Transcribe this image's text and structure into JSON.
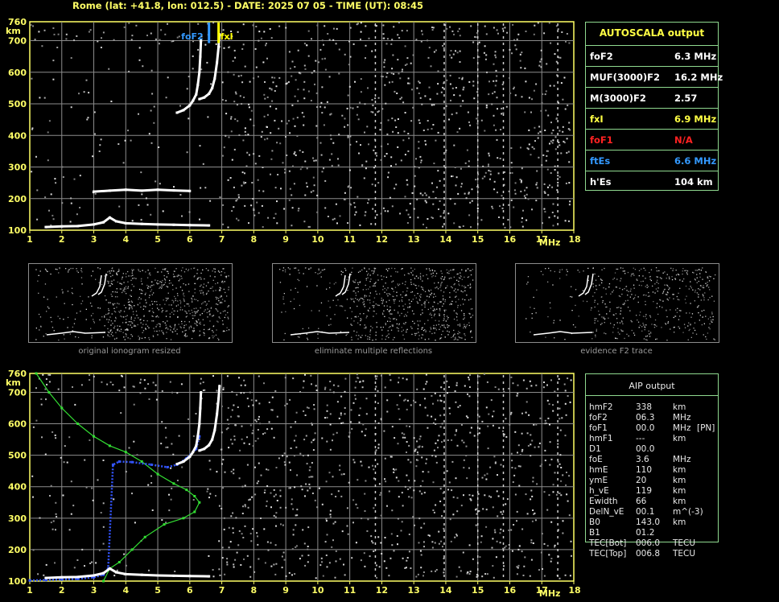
{
  "header": {
    "title": "Rome (lat: +41.8, lon: 012.5) - DATE: 2025 07 05 - TIME (UT): 08:45"
  },
  "colors": {
    "trace": "#ffffff",
    "grid": "#8c8c8c",
    "axis": "#ffff66",
    "green": "#33dd33",
    "blue": "#3355ff",
    "yellow": "#ffff00",
    "red": "#ff2222",
    "cyan_blue": "#3399ff"
  },
  "chart_data": [
    {
      "type": "scatter",
      "title": "",
      "xlabel": "MHz",
      "ylabel": "km",
      "xlim": [
        1,
        18
      ],
      "ylim": [
        100,
        760
      ],
      "x_ticks": [
        "1",
        "2",
        "3",
        "4",
        "5",
        "6",
        "7",
        "8",
        "9",
        "10",
        "11",
        "12",
        "13",
        "14",
        "15",
        "16",
        "17",
        "18"
      ],
      "y_ticks": [
        "100",
        "200",
        "300",
        "400",
        "500",
        "600",
        "700",
        "760"
      ],
      "grid": true,
      "markers": [
        {
          "label": "foF2",
          "x": 6.6,
          "color": "#3399ff"
        },
        {
          "label": "fxI",
          "x": 6.9,
          "color": "#ffff00"
        }
      ],
      "series": [
        {
          "name": "",
          "x": [
            5.6,
            5.8,
            6.0,
            6.1,
            6.2,
            6.25,
            6.3,
            6.33,
            6.35
          ],
          "y": [
            472,
            480,
            495,
            510,
            530,
            560,
            600,
            650,
            700
          ]
        },
        {
          "name": "",
          "x": [
            6.3,
            6.45,
            6.6,
            6.7,
            6.78,
            6.85,
            6.9,
            6.93
          ],
          "y": [
            515,
            520,
            532,
            550,
            580,
            630,
            680,
            720
          ]
        },
        {
          "name": "",
          "x": [
            1.5,
            2.0,
            2.5,
            3.0,
            3.3,
            3.5,
            3.7,
            4.0,
            4.5,
            5.0,
            5.5,
            6.0,
            6.6
          ],
          "y": [
            110,
            112,
            113,
            118,
            125,
            140,
            128,
            122,
            120,
            118,
            117,
            116,
            115
          ]
        },
        {
          "name": "",
          "x": [
            3.0,
            3.5,
            4.0,
            4.5,
            5.0,
            5.5,
            6.0
          ],
          "y": [
            222,
            225,
            228,
            225,
            228,
            226,
            224
          ]
        }
      ]
    },
    {
      "type": "line",
      "title": "",
      "xlabel": "MHz",
      "ylabel": "km",
      "xlim": [
        1,
        18
      ],
      "ylim": [
        100,
        760
      ],
      "x_ticks": [
        "1",
        "2",
        "3",
        "4",
        "5",
        "6",
        "7",
        "8",
        "9",
        "10",
        "11",
        "12",
        "13",
        "14",
        "15",
        "16",
        "17",
        "18"
      ],
      "y_ticks": [
        "100",
        "200",
        "300",
        "400",
        "500",
        "600",
        "700",
        "760"
      ],
      "grid": true,
      "series": [
        {
          "name": "",
          "x": [
            1.2,
            1.6,
            2.0,
            2.5,
            3.0,
            3.5,
            4.0,
            4.5,
            5.0,
            5.5,
            5.9,
            6.15,
            6.3,
            6.15,
            5.8,
            5.2,
            4.6,
            4.2,
            3.8,
            3.5,
            3.3
          ],
          "y": [
            760,
            700,
            650,
            600,
            560,
            530,
            510,
            480,
            440,
            410,
            390,
            370,
            350,
            320,
            300,
            280,
            240,
            200,
            160,
            140,
            100
          ]
        },
        {
          "name": "",
          "x": [
            1.0,
            1.5,
            2.0,
            2.5,
            3.0,
            3.3,
            3.45,
            3.6,
            3.8,
            4.2,
            4.8,
            5.3,
            5.6,
            5.9,
            6.2,
            6.3
          ],
          "y": [
            102,
            103,
            105,
            107,
            112,
            120,
            140,
            470,
            480,
            478,
            470,
            462,
            470,
            490,
            520,
            560
          ]
        },
        {
          "name": "",
          "x": [
            5.6,
            5.8,
            6.0,
            6.1,
            6.2,
            6.25,
            6.3,
            6.33,
            6.35
          ],
          "y": [
            472,
            480,
            495,
            510,
            530,
            560,
            600,
            650,
            700
          ]
        },
        {
          "name": "",
          "x": [
            6.3,
            6.45,
            6.6,
            6.7,
            6.78,
            6.85,
            6.9,
            6.93
          ],
          "y": [
            515,
            520,
            532,
            550,
            580,
            630,
            680,
            720
          ]
        },
        {
          "name": "",
          "x": [
            1.5,
            2.0,
            2.5,
            3.0,
            3.3,
            3.5,
            3.7,
            4.0,
            4.5,
            5.0,
            5.5,
            6.0,
            6.6
          ],
          "y": [
            110,
            112,
            113,
            118,
            125,
            140,
            128,
            122,
            120,
            118,
            117,
            116,
            115
          ]
        }
      ]
    }
  ],
  "thumbnails": [
    {
      "caption": "original ionogram resized"
    },
    {
      "caption": "eliminate multiple reflections"
    },
    {
      "caption": "evidence F2 trace"
    }
  ],
  "autoscala": {
    "title": "AUTOSCALA output",
    "rows": [
      {
        "label": "foF2",
        "value": "6.3 MHz",
        "color": "#ffffff"
      },
      {
        "label": "MUF(3000)F2",
        "value": "16.2 MHz",
        "color": "#ffffff"
      },
      {
        "label": "M(3000)F2",
        "value": "2.57",
        "color": "#ffffff"
      },
      {
        "label": "fxI",
        "value": "6.9  MHz",
        "color": "#ffff44"
      },
      {
        "label": "foF1",
        "value": "N/A",
        "color": "#ff2222"
      },
      {
        "label": "ftEs",
        "value": "6.6 MHz",
        "color": "#3399ff"
      },
      {
        "label": "h'Es",
        "value": "104    km",
        "color": "#ffffff"
      }
    ]
  },
  "aip": {
    "title": "AIP output",
    "rows": [
      {
        "p": "hmF2",
        "v": "338",
        "u": "km",
        "e": ""
      },
      {
        "p": "foF2",
        "v": "06.3",
        "u": "MHz",
        "e": ""
      },
      {
        "p": "foF1",
        "v": "00.0",
        "u": "MHz",
        "e": "[PN]"
      },
      {
        "p": "hmF1",
        "v": "---",
        "u": "km",
        "e": ""
      },
      {
        "p": "D1",
        "v": "00.0",
        "u": "",
        "e": ""
      },
      {
        "p": "foE",
        "v": "3.6",
        "u": "MHz",
        "e": ""
      },
      {
        "p": "hmE",
        "v": "110",
        "u": "km",
        "e": ""
      },
      {
        "p": "ymE",
        "v": "20",
        "u": "km",
        "e": ""
      },
      {
        "p": "h_vE",
        "v": "119",
        "u": "km",
        "e": ""
      },
      {
        "p": "Ewidth",
        "v": "66",
        "u": "km",
        "e": ""
      },
      {
        "p": "DelN_vE",
        "v": "00.1",
        "u": "m^(-3)",
        "e": ""
      },
      {
        "p": "B0",
        "v": "143.0",
        "u": "km",
        "e": ""
      },
      {
        "p": "B1",
        "v": "01.2",
        "u": "",
        "e": ""
      },
      {
        "p": "TEC[Bot]",
        "v": "006.0",
        "u": "TECU",
        "e": ""
      },
      {
        "p": "TEC[Top]",
        "v": "006.8",
        "u": "TECU",
        "e": ""
      }
    ]
  }
}
